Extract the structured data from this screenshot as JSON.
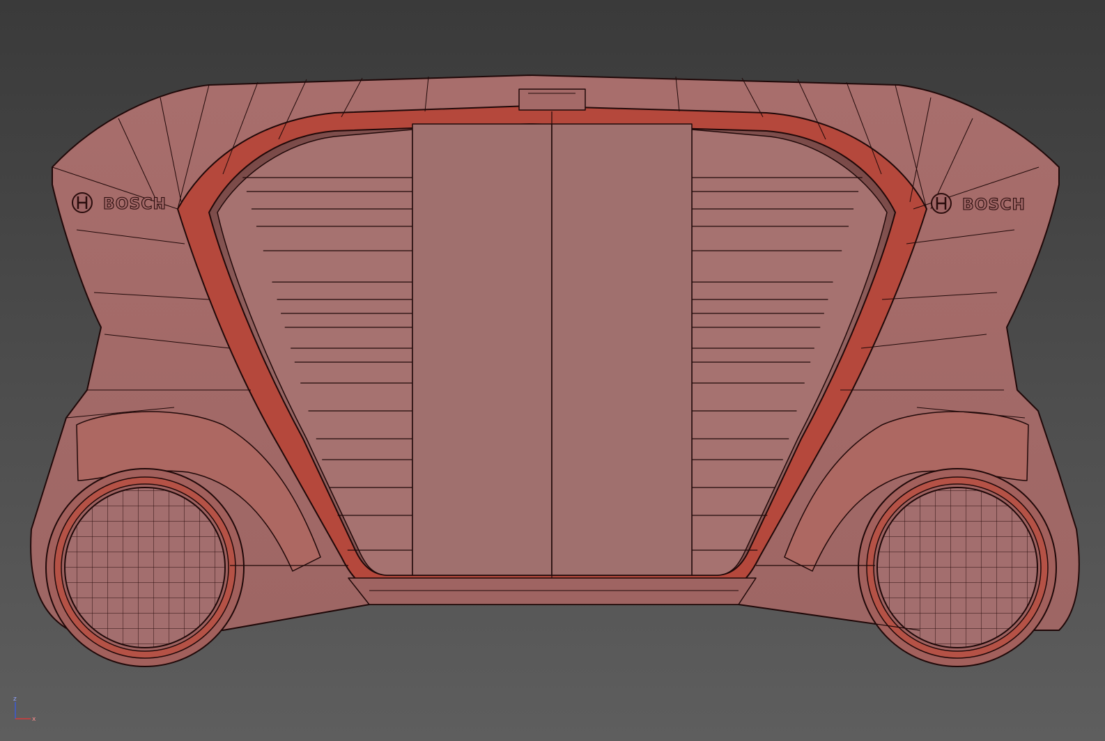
{
  "viewport": {
    "model": {
      "logos": [
        {
          "text": "BOSCH",
          "icon": "bosch-armature-icon"
        },
        {
          "text": "BOSCH",
          "icon": "bosch-armature-icon"
        }
      ]
    },
    "axis_gizmo": {
      "z_label": "z",
      "x_label": "x"
    }
  },
  "colors": {
    "background_top": "#3b3b3b",
    "background_bottom": "#5c5c5c",
    "body_fill": "#a36e6e",
    "edge_shadow": "#b24a3f",
    "wireframe": "#1f0808"
  }
}
